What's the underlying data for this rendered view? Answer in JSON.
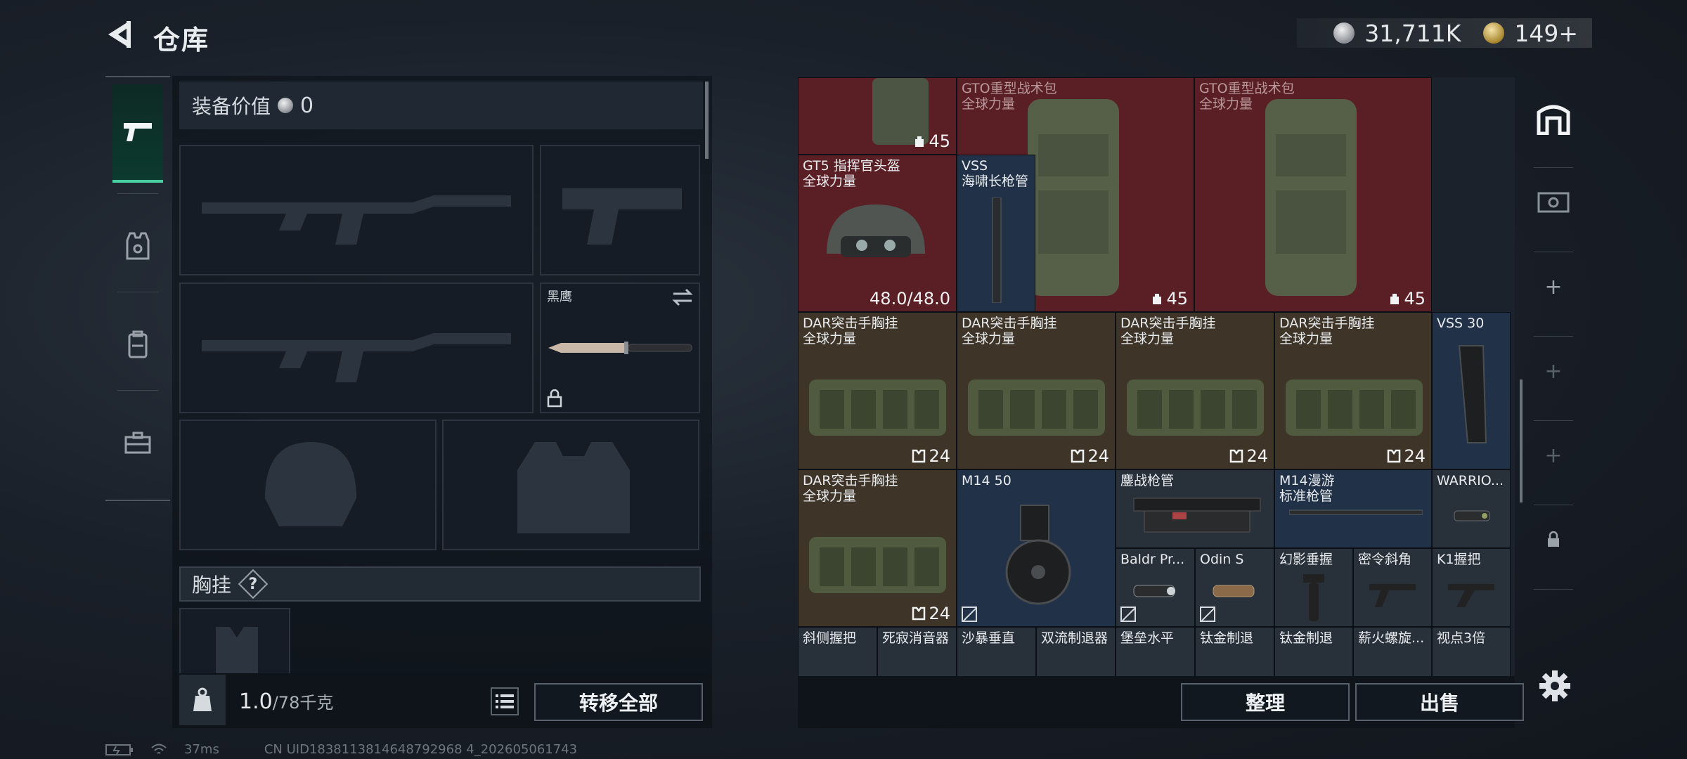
{
  "header": {
    "title": "仓库",
    "back_icon": "back-arrow-icon"
  },
  "currency": {
    "silver": "31,711K",
    "gold": "149+"
  },
  "left": {
    "tabs": [
      {
        "name": "weapons",
        "icon": "pistol-icon",
        "active": true
      },
      {
        "name": "armor",
        "icon": "vest-icon"
      },
      {
        "name": "backpack",
        "icon": "backpack-icon"
      },
      {
        "name": "case",
        "icon": "briefcase-icon"
      }
    ],
    "equip_value_label": "装备价值",
    "equip_value": "0",
    "knife_name": "黑鹰",
    "chest_label": "胸挂",
    "chest_help": "?",
    "weight": "1.0",
    "weight_unit": "/78千克",
    "transfer_all": "转移全部"
  },
  "grid": {
    "r1": [
      {
        "name": "",
        "num": "45"
      },
      {
        "name": "GTO重型战术包\n全球力量",
        "num": "45"
      },
      {
        "name": "GTO重型战术包\n全球力量",
        "num": "45"
      }
    ],
    "helmet": {
      "name": "GT5 指挥官头盔\n全球力量",
      "dur": "48.0/48.0"
    },
    "vss_barrel": {
      "name": "VSS\n海啸长枪管"
    },
    "rigs": [
      {
        "name": "DAR突击手胸挂\n全球力量",
        "num": "24"
      },
      {
        "name": "DAR突击手胸挂\n全球力量",
        "num": "24"
      },
      {
        "name": "DAR突击手胸挂\n全球力量",
        "num": "24"
      },
      {
        "name": "DAR突击手胸挂\n全球力量",
        "num": "24"
      },
      {
        "name": "DAR突击手胸挂\n全球力量",
        "num": "24"
      }
    ],
    "vss30": {
      "name": "VSS 30"
    },
    "m14mag": {
      "name": "M14 50"
    },
    "handguard": {
      "name": "鏖战枪管"
    },
    "m14barrel": {
      "name": "M14漫游\n标准枪管"
    },
    "warrior": {
      "name": "WARRIO..."
    },
    "baldr": {
      "name": "Baldr Pr..."
    },
    "odin": {
      "name": "Odin S"
    },
    "grip1": {
      "name": "幻影垂握"
    },
    "angle": {
      "name": "密令斜角"
    },
    "k1": {
      "name": "K1握把"
    },
    "row6": [
      {
        "name": "斜侧握把"
      },
      {
        "name": "死寂消音器"
      },
      {
        "name": "沙暴垂直"
      },
      {
        "name": "双流制退器"
      },
      {
        "name": "堡垒水平"
      },
      {
        "name": "钛金制退"
      },
      {
        "name": "钛金制退"
      },
      {
        "name": "薪火螺旋..."
      },
      {
        "name": "视点3倍"
      }
    ],
    "sort": "整理",
    "sell": "出售"
  },
  "rail": {
    "items": [
      "home-icon",
      "cash-icon",
      "plus-icon",
      "plus-icon",
      "plus-icon",
      "lock-icon"
    ]
  },
  "status": {
    "ping": "37ms",
    "uid": "CN UID1838113814648792968 4_202605061743"
  }
}
